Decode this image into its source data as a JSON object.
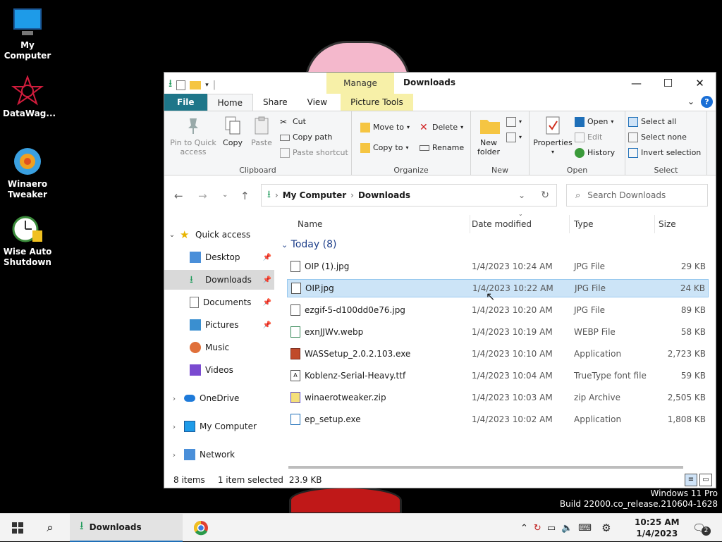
{
  "desktop": {
    "icons": [
      {
        "label": "My Computer"
      },
      {
        "label": "DataWag..."
      },
      {
        "label": "Winaero Tweaker"
      },
      {
        "label": "Wise Auto Shutdown"
      }
    ],
    "watermark_line1": "Windows 11 Pro",
    "watermark_line2": "Build 22000.co_release.210604-1628"
  },
  "window": {
    "title": "Downloads",
    "manage_label": "Manage",
    "tabs": {
      "file": "File",
      "home": "Home",
      "share": "Share",
      "view": "View",
      "picture_tools": "Picture Tools"
    },
    "ribbon": {
      "clipboard": {
        "label": "Clipboard",
        "pin": "Pin to Quick access",
        "copy": "Copy",
        "paste": "Paste",
        "cut": "Cut",
        "copy_path": "Copy path",
        "paste_shortcut": "Paste shortcut"
      },
      "organize": {
        "label": "Organize",
        "move_to": "Move to",
        "copy_to": "Copy to",
        "delete": "Delete",
        "rename": "Rename"
      },
      "new": {
        "label": "New",
        "new_folder": "New folder"
      },
      "open": {
        "label": "Open",
        "properties": "Properties",
        "open": "Open",
        "edit": "Edit",
        "history": "History"
      },
      "select": {
        "label": "Select",
        "select_all": "Select all",
        "select_none": "Select none",
        "invert": "Invert selection"
      }
    },
    "address": {
      "crumb1": "My Computer",
      "crumb2": "Downloads"
    },
    "search_placeholder": "Search Downloads",
    "nav": {
      "quick_access": "Quick access",
      "desktop": "Desktop",
      "downloads": "Downloads",
      "documents": "Documents",
      "pictures": "Pictures",
      "music": "Music",
      "videos": "Videos",
      "onedrive": "OneDrive",
      "mycomputer": "My Computer",
      "network": "Network"
    },
    "columns": {
      "name": "Name",
      "date": "Date modified",
      "type": "Type",
      "size": "Size"
    },
    "group_header": "Today (8)",
    "files": [
      {
        "name": "OIP (1).jpg",
        "date": "1/4/2023 10:24 AM",
        "type": "JPG File",
        "size": "29 KB"
      },
      {
        "name": "OIP.jpg",
        "date": "1/4/2023 10:22 AM",
        "type": "JPG File",
        "size": "24 KB"
      },
      {
        "name": "ezgif-5-d100dd0e76.jpg",
        "date": "1/4/2023 10:20 AM",
        "type": "JPG File",
        "size": "89 KB"
      },
      {
        "name": "exnJJWv.webp",
        "date": "1/4/2023 10:19 AM",
        "type": "WEBP File",
        "size": "58 KB"
      },
      {
        "name": "WASSetup_2.0.2.103.exe",
        "date": "1/4/2023 10:10 AM",
        "type": "Application",
        "size": "2,723 KB"
      },
      {
        "name": "Koblenz-Serial-Heavy.ttf",
        "date": "1/4/2023 10:04 AM",
        "type": "TrueType font file",
        "size": "59 KB"
      },
      {
        "name": "winaerotweaker.zip",
        "date": "1/4/2023 10:03 AM",
        "type": "zip Archive",
        "size": "2,505 KB"
      },
      {
        "name": "ep_setup.exe",
        "date": "1/4/2023 10:02 AM",
        "type": "Application",
        "size": "1,808 KB"
      }
    ],
    "status": {
      "items": "8 items",
      "selected": "1 item selected",
      "size": "23.9 KB"
    }
  },
  "taskbar": {
    "downloads_label": "Downloads",
    "time": "10:25 AM",
    "date": "1/4/2023",
    "notif_count": "2"
  }
}
